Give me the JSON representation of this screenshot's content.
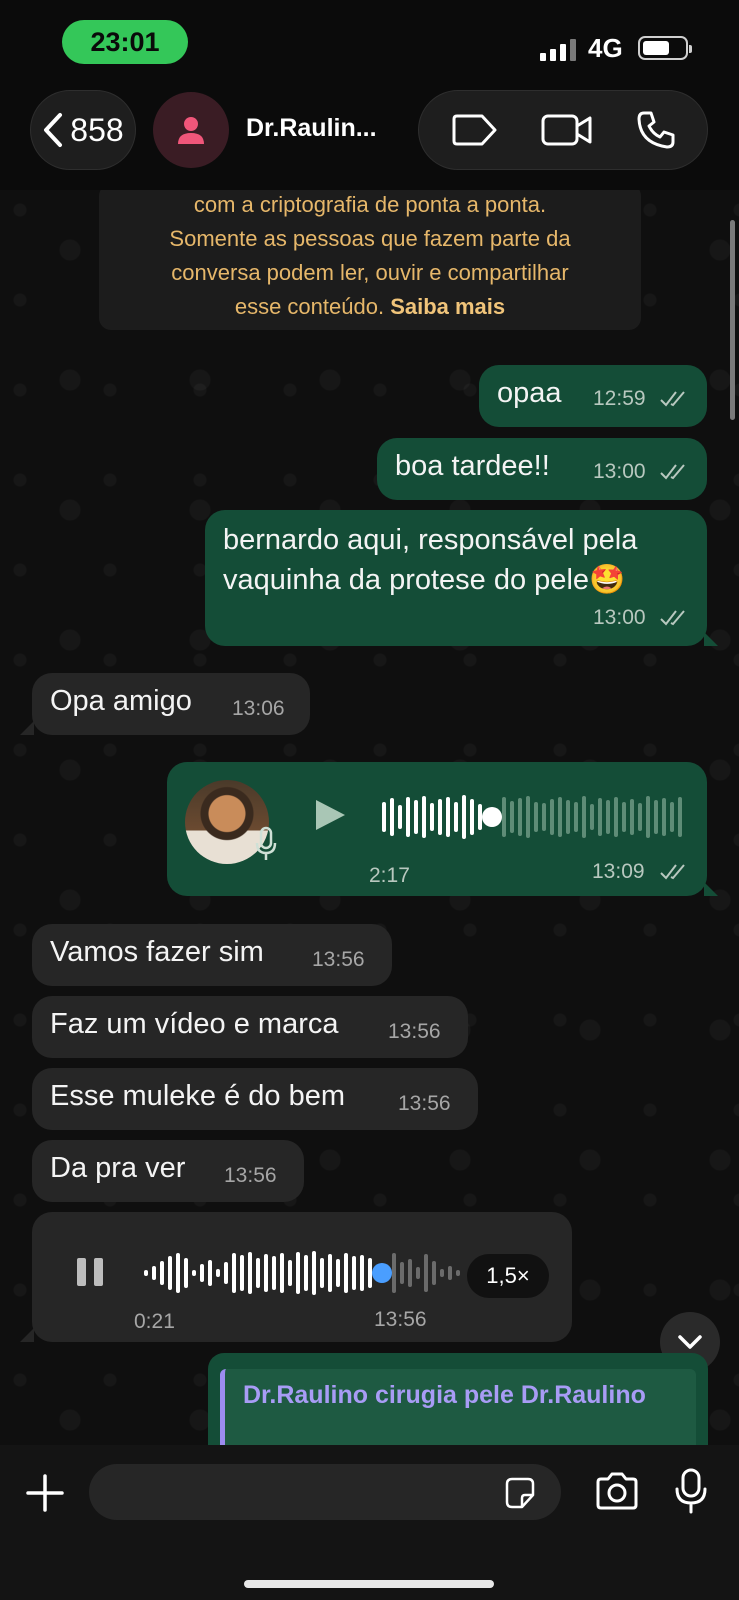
{
  "status": {
    "time": "23:01",
    "network": "4G"
  },
  "header": {
    "back_count": "858",
    "contact_name": "Dr.Raulin..."
  },
  "encryption": {
    "line1": "com a criptografia de ponta a ponta.",
    "line2": "Somente as pessoas que fazem parte da",
    "line3": "conversa podem ler, ouvir e compartilhar",
    "line4_prefix": "esse conteúdo. ",
    "link": "Saiba mais"
  },
  "messages": [
    {
      "dir": "out",
      "text": "opaa",
      "time": "12:59"
    },
    {
      "dir": "out",
      "text": "boa tardee!!",
      "time": "13:00"
    },
    {
      "dir": "out",
      "text_line1": "bernardo aqui, responsável pela",
      "text_line2": "vaquinha da protese do pele🤩",
      "time": "13:00"
    },
    {
      "dir": "in",
      "text": "Opa amigo",
      "time": "13:06"
    },
    {
      "dir": "out",
      "type": "voice",
      "duration": "2:17",
      "time": "13:09",
      "progress": 0.37
    },
    {
      "dir": "in",
      "text": "Vamos fazer sim",
      "time": "13:56"
    },
    {
      "dir": "in",
      "text": "Faz um vídeo e marca",
      "time": "13:56"
    },
    {
      "dir": "in",
      "text": "Esse muleke é do bem",
      "time": "13:56"
    },
    {
      "dir": "in",
      "text": "Da pra ver",
      "time": "13:56"
    },
    {
      "dir": "in",
      "type": "voice",
      "elapsed": "0:21",
      "time": "13:56",
      "speed": "1,5×",
      "progress": 0.77
    }
  ],
  "reply_preview": {
    "name": "Dr.Raulino cirugia pele Dr.Raulino"
  },
  "colors": {
    "outgoing": "#144d37",
    "incoming": "#262626",
    "accent": "#34c759",
    "progress_dot": "#4a9eff"
  }
}
